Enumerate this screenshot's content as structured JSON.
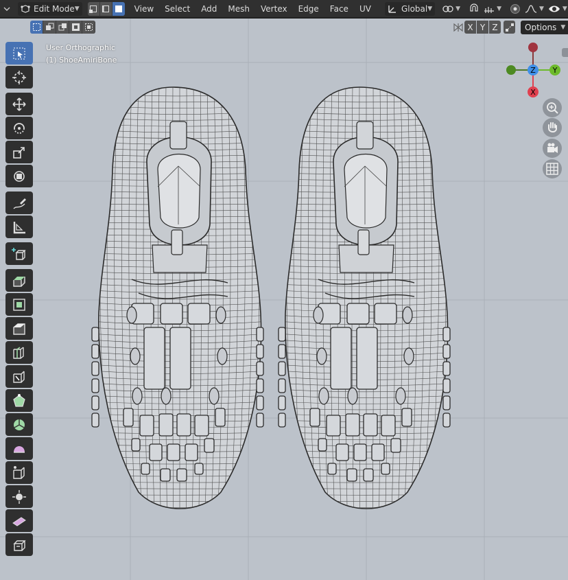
{
  "header": {
    "editor_type": "3d-viewport-icon",
    "mode": "Edit Mode",
    "menus": [
      "View",
      "Select",
      "Add",
      "Mesh",
      "Vertex",
      "Edge",
      "Face",
      "UV"
    ],
    "orientation": "Global"
  },
  "subheader": {
    "axes": [
      "X",
      "Y",
      "Z"
    ],
    "options_label": "Options"
  },
  "viewport": {
    "view_name": "User Orthographic",
    "object_name": "(1) ShoeAmiriBone"
  },
  "gizmo": {
    "axis_z": "Z",
    "axis_y": "Y",
    "axis_x": "X",
    "colors": {
      "x": "#e0404f",
      "y": "#6dba2b",
      "z": "#3f8fe8"
    }
  },
  "toolbar": {
    "tools": [
      "select-box",
      "cursor",
      "move",
      "rotate",
      "scale",
      "transform",
      "annotate",
      "measure",
      "add-cube",
      "extrude-region",
      "inset-faces",
      "bevel",
      "loop-cut",
      "knife",
      "poly-build",
      "spin",
      "smooth",
      "edge-slide",
      "shrink-fatten",
      "shear",
      "rip-region"
    ]
  },
  "colors": {
    "accent": "#4772b3",
    "viewport_bg": "#bcc2ca",
    "header_bg": "#303030"
  }
}
